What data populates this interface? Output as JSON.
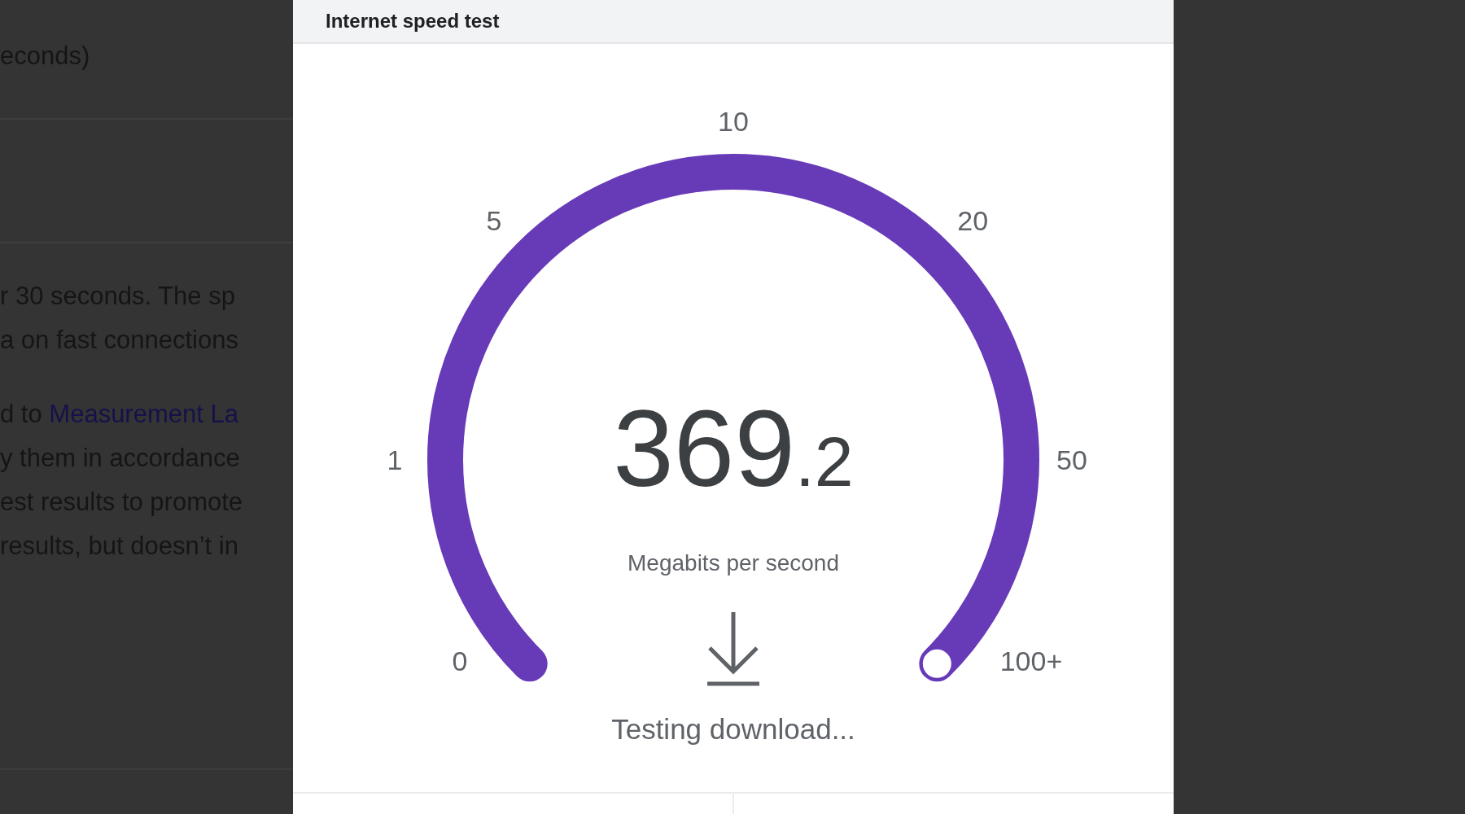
{
  "background_page": {
    "heading_fragment": "econds)",
    "paragraph_1": [
      "r 30 seconds. The sp",
      "a on fast connections"
    ],
    "paragraph_2": {
      "link_line_prefix": "d to ",
      "link": "Measurement La",
      "lines": [
        "y them in accordance",
        "est results to promote",
        "results, but doesn’t in"
      ]
    }
  },
  "dialog": {
    "title": "Internet speed test",
    "gauge": {
      "ticks": [
        "0",
        "1",
        "5",
        "10",
        "20",
        "50",
        "100+"
      ],
      "level": 1,
      "value_integer": "369",
      "value_decimal": ".2",
      "unit": "Megabits per second",
      "status": "Testing download..."
    }
  }
}
